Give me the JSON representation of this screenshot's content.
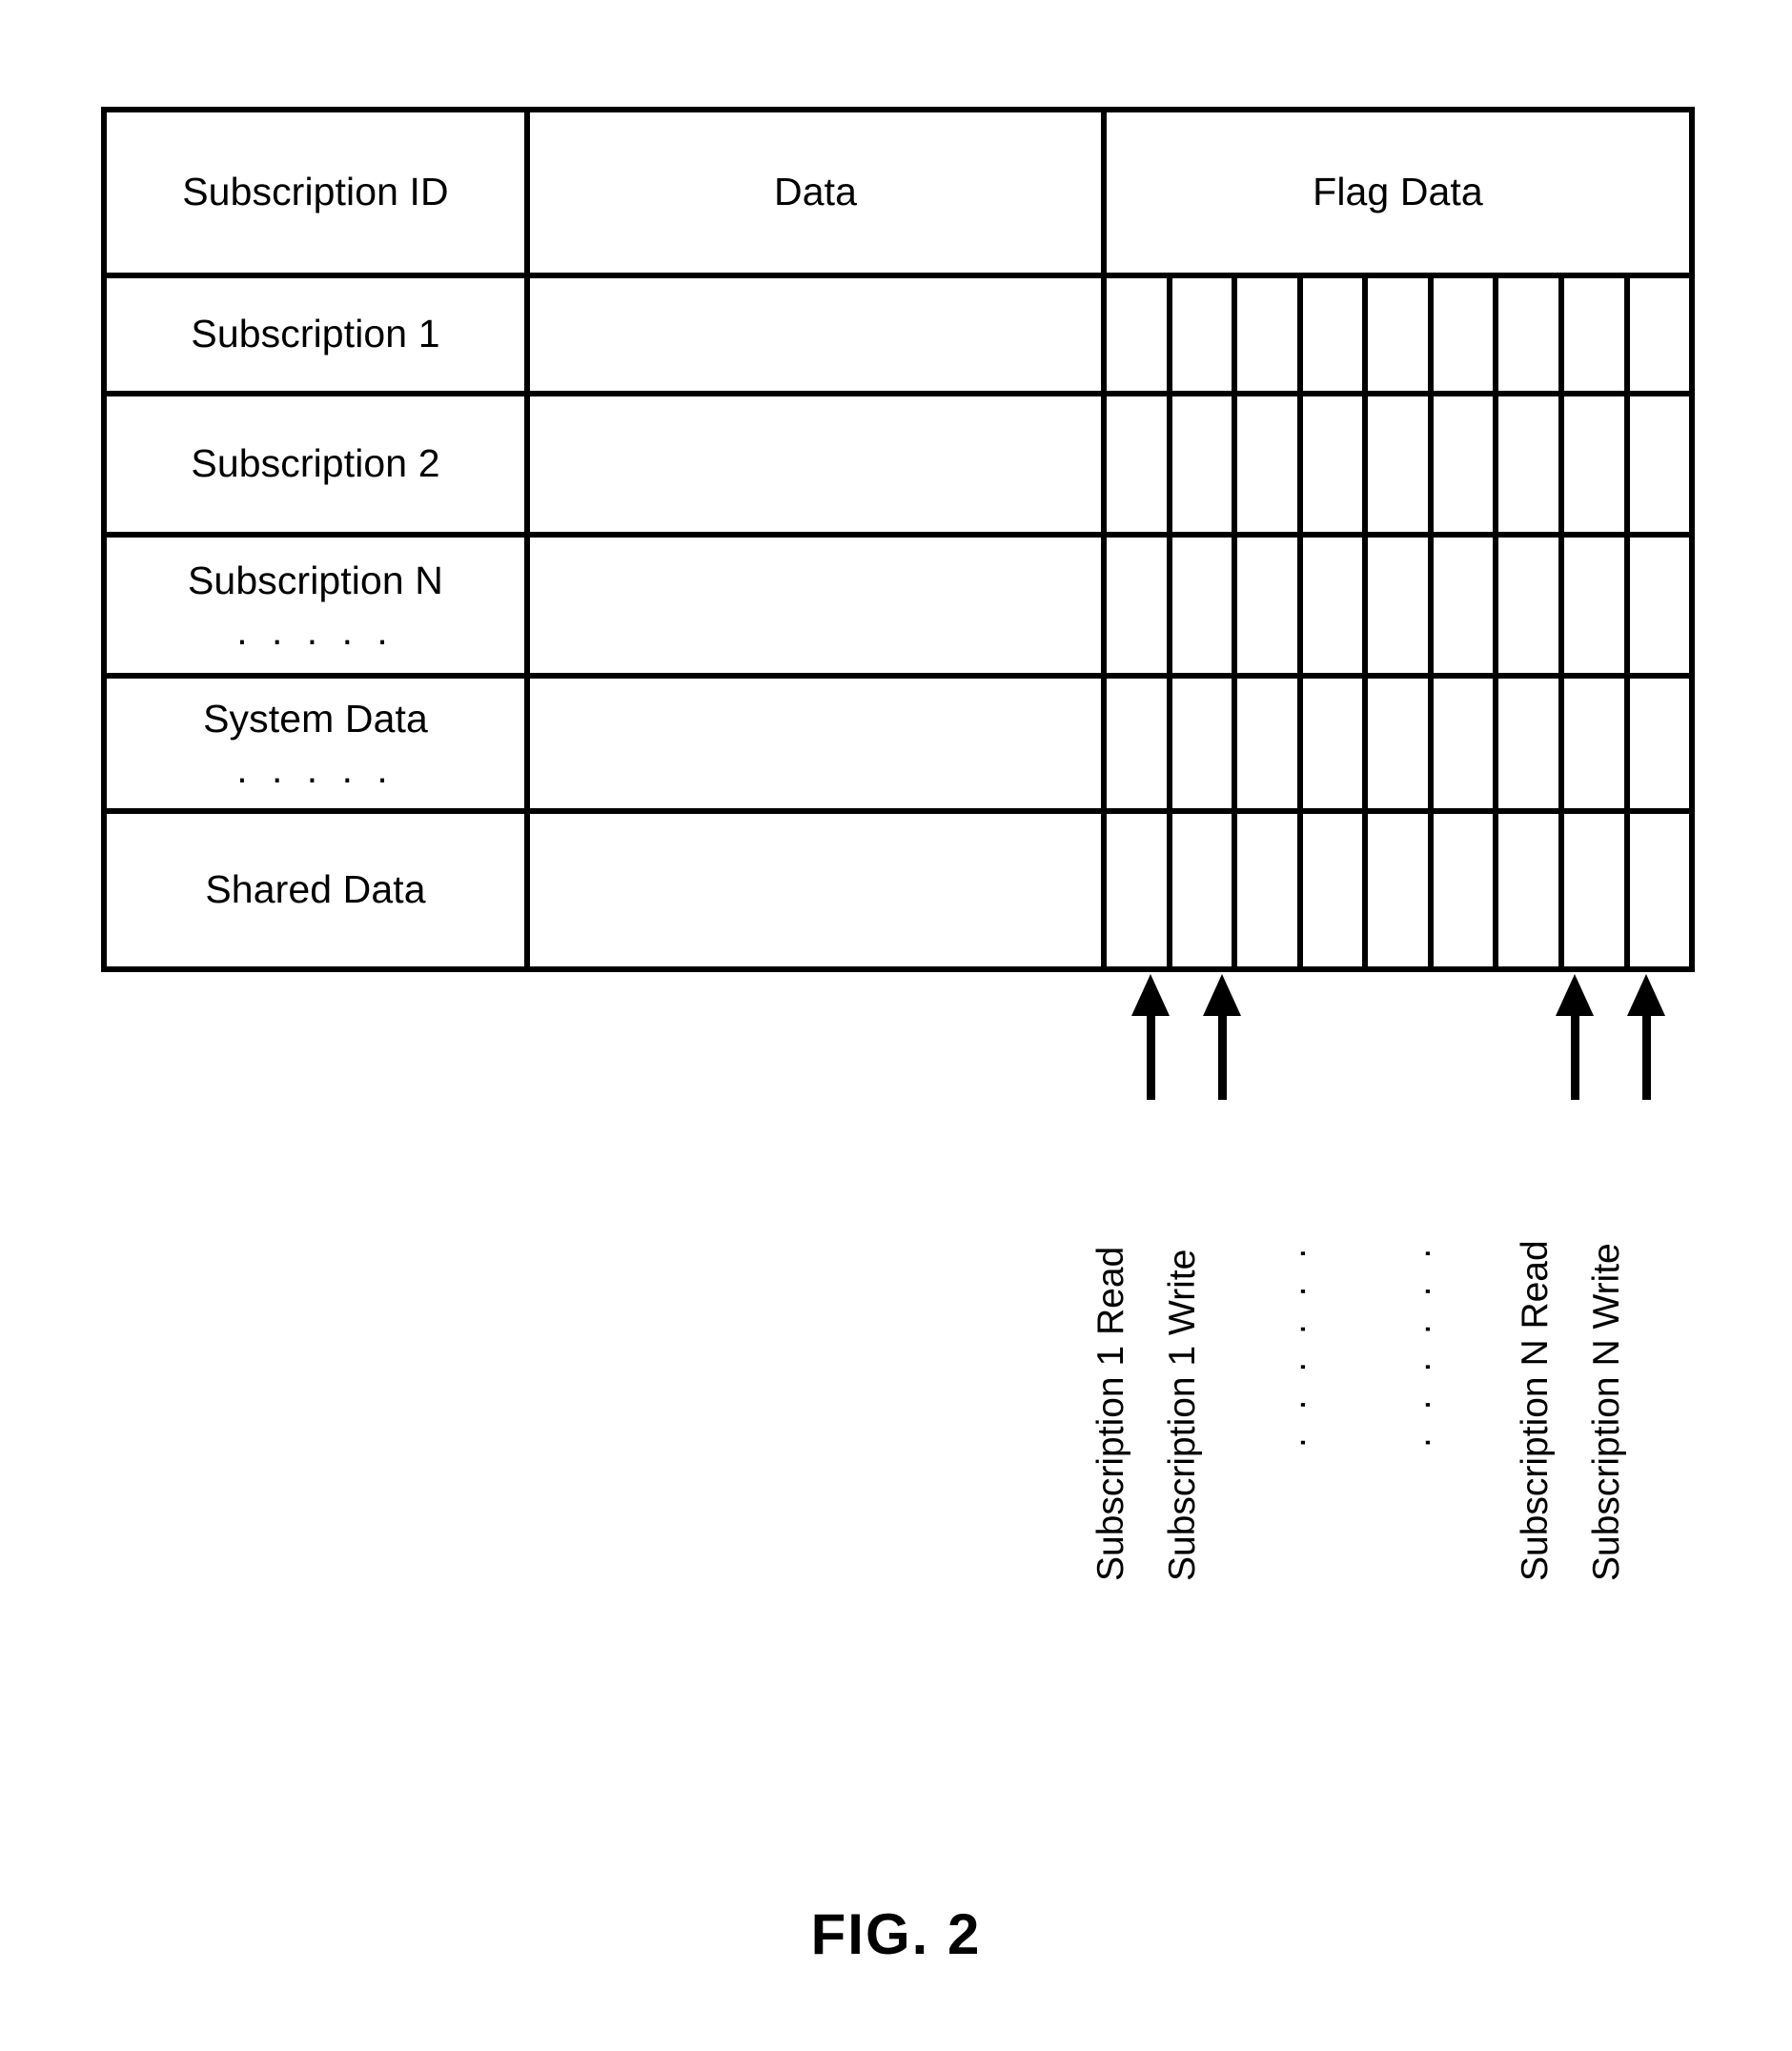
{
  "figure": {
    "caption": "FIG. 2"
  },
  "table": {
    "headers": [
      {
        "label": "Subscription ID"
      },
      {
        "label": "Data"
      },
      {
        "label": "Flag Data"
      }
    ],
    "rows": [
      {
        "id_label": "Subscription 1",
        "id_dots": "",
        "data": "",
        "flags": ""
      },
      {
        "id_label": "Subscription 2",
        "id_dots": "",
        "data": "",
        "flags": ""
      },
      {
        "id_label": "Subscription N",
        "id_dots": ". . . . .",
        "data": "",
        "flags": ""
      },
      {
        "id_label": "System Data",
        "id_dots": ". . . . .",
        "data": "",
        "flags": ""
      },
      {
        "id_label": "Shared Data",
        "id_dots": "",
        "data": "",
        "flags": ""
      }
    ],
    "flag_column_count": 9
  },
  "flag_callouts": [
    {
      "label": "Subscription 1 Read"
    },
    {
      "label": "Subscription 1 Write"
    },
    {
      "label": "Subscription N Read"
    },
    {
      "label": "Subscription N Write"
    }
  ],
  "flag_ellipses": [
    {
      "dots": ". . . . . ."
    },
    {
      "dots": ". . . . . ."
    }
  ],
  "colors": {
    "line": "#000000",
    "background": "#ffffff",
    "text": "#000000"
  }
}
